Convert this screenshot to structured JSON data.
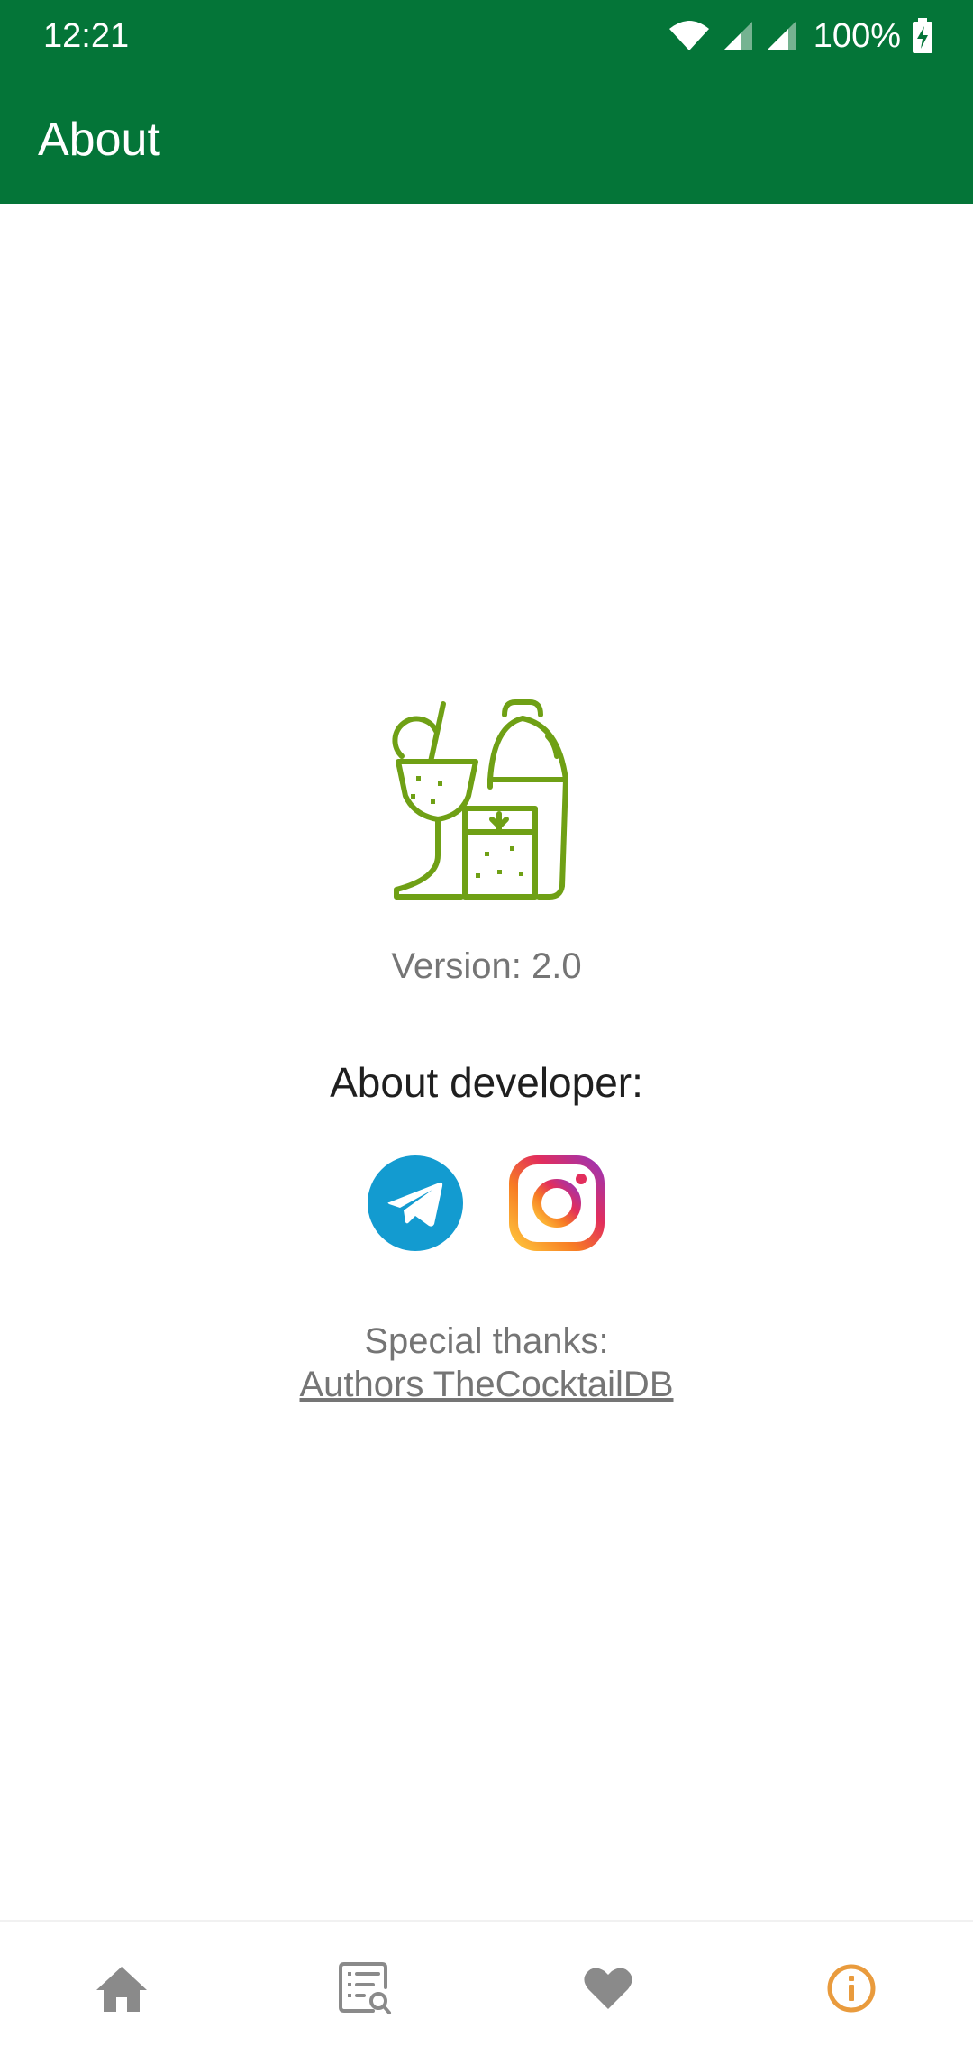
{
  "status_bar": {
    "time": "12:21",
    "battery_percent": "100%",
    "icons": [
      "wifi-icon",
      "signal-icon",
      "signal-icon",
      "battery-charging-icon"
    ]
  },
  "app_bar": {
    "title": "About"
  },
  "about": {
    "logo_icon": "cocktail-shaker-icon",
    "version_text": "Version: 2.0",
    "developer_heading": "About developer:",
    "social_links": [
      {
        "name": "telegram",
        "icon": "telegram-icon"
      },
      {
        "name": "instagram",
        "icon": "instagram-icon"
      }
    ],
    "thanks_label": "Special thanks:",
    "thanks_link": "Authors TheCocktailDB"
  },
  "bottom_nav": {
    "items": [
      {
        "icon": "home-icon",
        "selected": false
      },
      {
        "icon": "search-list-icon",
        "selected": false
      },
      {
        "icon": "heart-icon",
        "selected": false
      },
      {
        "icon": "info-icon",
        "selected": true
      }
    ]
  },
  "colors": {
    "primary": "#047538",
    "accent": "#E99B3D",
    "logo": "#6FA015",
    "telegram": "#139BD0",
    "nav_inactive": "#8A8A8A",
    "text_secondary": "#757575"
  }
}
